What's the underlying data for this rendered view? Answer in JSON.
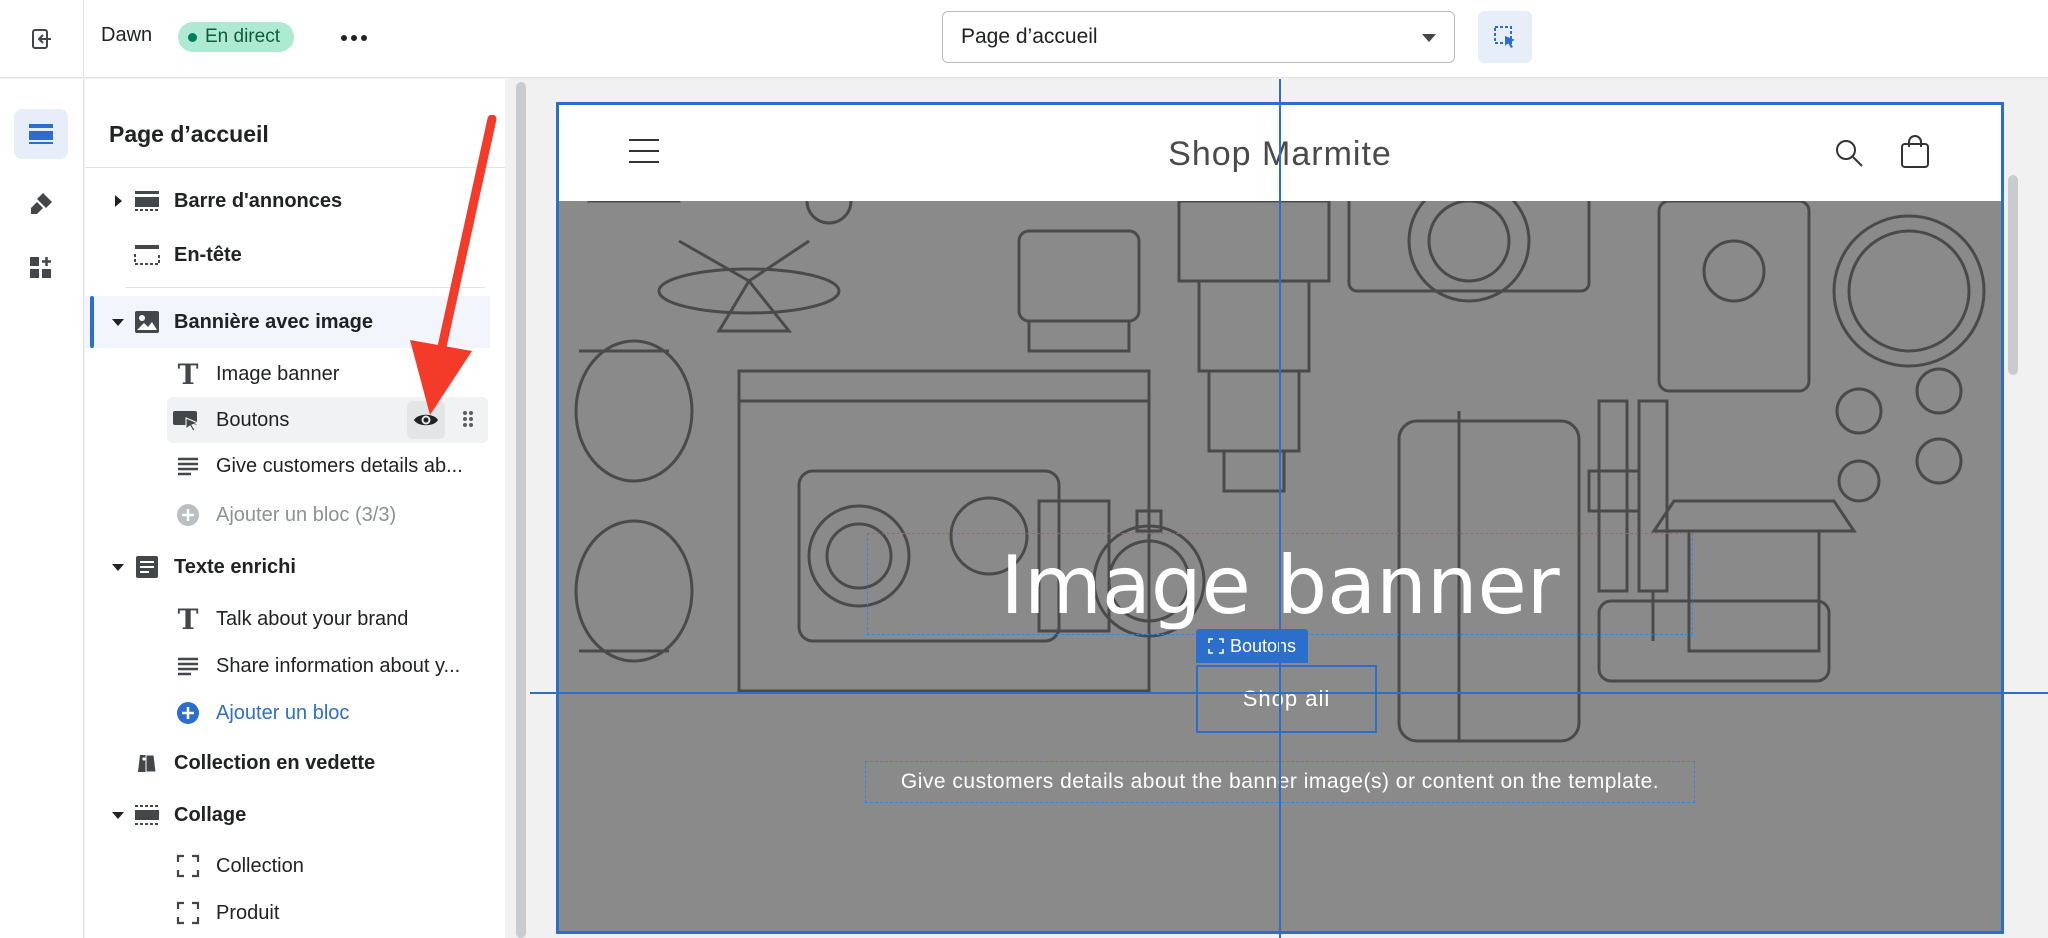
{
  "topbar": {
    "theme_name": "Dawn",
    "live_badge": "En direct",
    "page_select_value": "Page d’accueil"
  },
  "rail": {
    "items": [
      "sections-icon",
      "theme-settings-icon",
      "app-embeds-icon"
    ]
  },
  "sidebar": {
    "title": "Page d’accueil",
    "sections": [
      {
        "label": "Barre d'annonces"
      },
      {
        "label": "En-tête"
      },
      {
        "label": "Bannière avec image",
        "blocks": [
          "Image banner",
          "Boutons",
          "Give customers details ab...",
          "Ajouter un bloc (3/3)"
        ]
      },
      {
        "label": "Texte enrichi",
        "blocks": [
          "Talk about your brand",
          "Share information about y...",
          "Ajouter un bloc"
        ]
      },
      {
        "label": "Collection en vedette"
      },
      {
        "label": "Collage",
        "blocks": [
          "Collection",
          "Produit"
        ]
      }
    ]
  },
  "preview": {
    "shop_title": "Shop Marmite",
    "banner_heading": "Image banner",
    "button_tag": "Boutons",
    "button_label": "Shop all",
    "banner_description": "Give customers details about the banner image(s) or content on the template."
  },
  "colors": {
    "accent": "#2c6ecb",
    "live_badge_bg": "#aee9d1",
    "banner_overlay": "#8a8a8a",
    "annotation_arrow": "#f43b2a"
  }
}
